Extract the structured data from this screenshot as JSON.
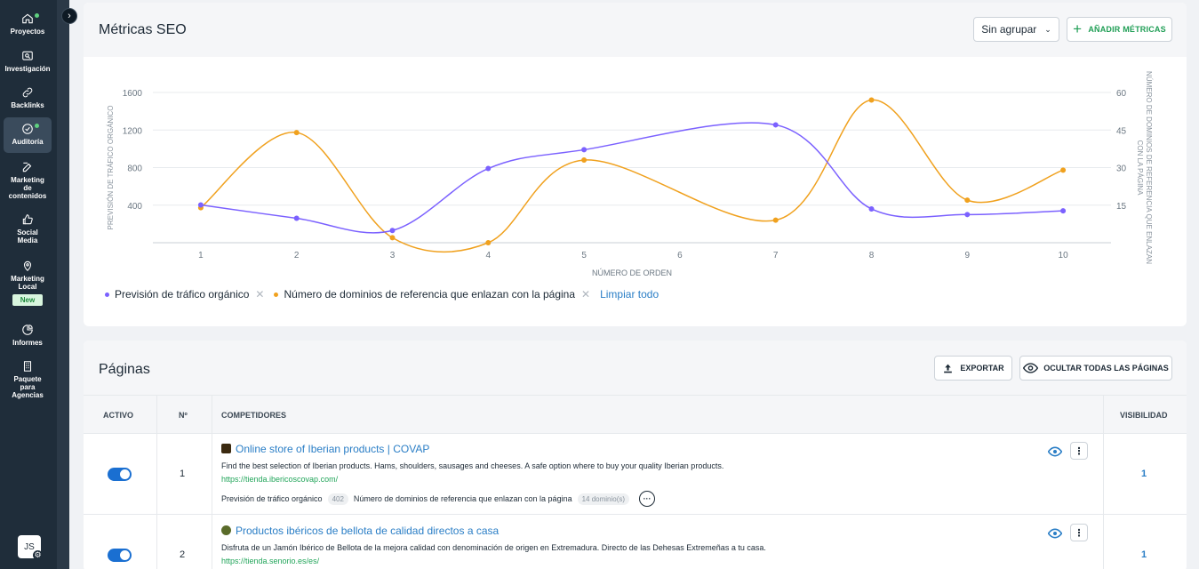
{
  "sidebar": {
    "items": [
      {
        "label": "Proyectos",
        "icon": "home-icon",
        "dot": true
      },
      {
        "label": "Investigación",
        "icon": "search-window-icon"
      },
      {
        "label": "Backlinks",
        "icon": "link-icon"
      },
      {
        "label": "Auditoría",
        "icon": "check-circle-icon",
        "dot": true,
        "active": true
      },
      {
        "label": "Marketing de contenidos",
        "icon": "edit-icon"
      },
      {
        "label": "Social Media",
        "icon": "thumbs-up-icon"
      },
      {
        "label": "Marketing Local",
        "icon": "map-pin-icon",
        "badge": "New"
      },
      {
        "label": "Informes",
        "icon": "pie-chart-icon"
      },
      {
        "label": "Paquete para Agencias",
        "icon": "building-icon"
      }
    ],
    "avatar_initials": "JS"
  },
  "metrics": {
    "title": "Métricas SEO",
    "group_select": "Sin agrupar",
    "add_metrics_label": "AÑADIR MÉTRICAS",
    "legend_clear": "Limpiar todo"
  },
  "chart_data": {
    "type": "line",
    "x": [
      1,
      2,
      3,
      4,
      5,
      6,
      7,
      8,
      9,
      10
    ],
    "xlabel": "NÚMERO DE ORDEN",
    "ylabel_left": "PREVISIÓN DE TRÁFICO ORGÁNICO",
    "ylabel_right": "NÚMERO DE DOMINIOS DE REFERENCIA QUE ENLAZAN CON LA PÁGINA",
    "ylim_left": [
      0,
      1600
    ],
    "yticks_left": [
      400,
      800,
      1200,
      1600
    ],
    "ylim_right": [
      0,
      60
    ],
    "yticks_right": [
      15,
      30,
      45,
      60
    ],
    "series": [
      {
        "name": "Previsión de tráfico orgánico",
        "axis": "left",
        "color": "#7b61ff",
        "points": [
          [
            1,
            402
          ],
          [
            2,
            260
          ],
          [
            3,
            130
          ],
          [
            4,
            790
          ],
          [
            5,
            990
          ],
          [
            7,
            1255
          ],
          [
            8,
            360
          ],
          [
            9,
            300
          ],
          [
            10,
            340
          ]
        ]
      },
      {
        "name": "Número de dominios de referencia que enlazan con la página",
        "axis": "right",
        "color": "#f0a11e",
        "points": [
          [
            1,
            14
          ],
          [
            2,
            44
          ],
          [
            3,
            2
          ],
          [
            4,
            0
          ],
          [
            5,
            33
          ],
          [
            7,
            9
          ],
          [
            8,
            57
          ],
          [
            9,
            17
          ],
          [
            10,
            29
          ]
        ]
      }
    ],
    "grid": true,
    "legend": "bottom-left"
  },
  "pages": {
    "title": "Páginas",
    "export_label": "EXPORTAR",
    "hide_all_label": "OCULTAR TODAS LAS PÁGINAS",
    "columns": {
      "active": "ACTIVO",
      "num": "Nº",
      "competitors": "COMPETIDORES",
      "visibility": "VISIBILIDAD"
    },
    "rows": [
      {
        "num": "1",
        "title": "Online store of Iberian products | COVAP",
        "description": "Find the best selection of Iberian products. Hams, shoulders, sausages and cheeses. A safe option where to buy your quality Iberian products.",
        "url": "https://tienda.ibericoscovap.com/",
        "metric1_label": "Previsión de tráfico orgánico",
        "metric1_value": "402",
        "metric2_label": "Número de dominios de referencia que enlazan con la página",
        "metric2_value": "14 dominio(s)",
        "visibility": "1"
      },
      {
        "num": "2",
        "title": "Productos ibéricos de bellota de calidad directos a casa",
        "description": "Disfruta de un Jamón Ibérico de Bellota de la mejora calidad con denominación de origen en Extremadura. Directo de las Dehesas Extremeñas a tu casa.",
        "url": "https://tienda.senorio.es/es/",
        "visibility": "1"
      }
    ]
  }
}
